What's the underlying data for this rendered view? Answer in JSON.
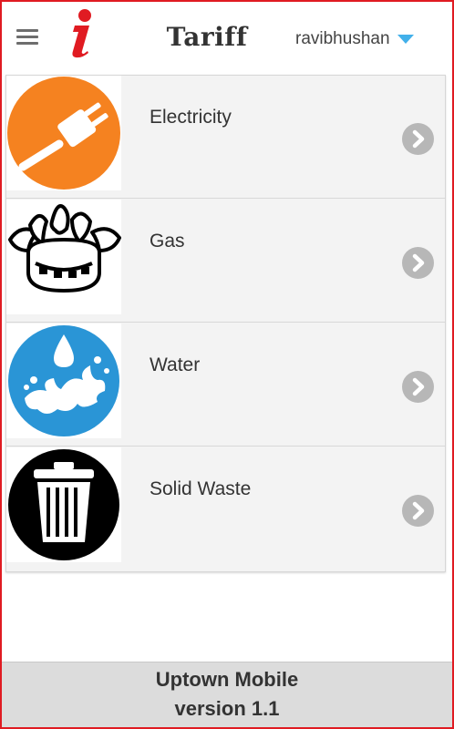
{
  "header": {
    "title": "Tariff",
    "username": "ravibhushan",
    "menu_icon": "hamburger-menu-icon",
    "logo_icon": "info-logo-icon",
    "caret_icon": "caret-down-icon"
  },
  "colors": {
    "frame": "#e01b22",
    "electricity": "#f58220",
    "water": "#2a95d6",
    "solid_waste": "#000000",
    "caret": "#42b0ea",
    "arrow": "#b7b7b7"
  },
  "tariff_list": [
    {
      "label": "Electricity",
      "icon": "plug-icon"
    },
    {
      "label": "Gas",
      "icon": "gas-burner-icon"
    },
    {
      "label": "Water",
      "icon": "water-splash-icon"
    },
    {
      "label": "Solid Waste",
      "icon": "trash-can-icon"
    }
  ],
  "footer": {
    "app_name": "Uptown Mobile",
    "version": "version 1.1"
  }
}
